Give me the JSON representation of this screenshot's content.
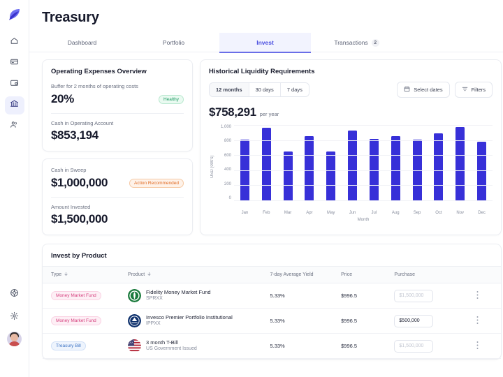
{
  "app": {
    "brand_color": "#4b4fe0",
    "bar_color": "#3730d8",
    "logo_name": "app-logo"
  },
  "sidebar": {
    "items": [
      {
        "icon": "home-icon",
        "label": "Home"
      },
      {
        "icon": "card-icon",
        "label": "Cards"
      },
      {
        "icon": "wallet-icon",
        "label": "Wallet"
      },
      {
        "icon": "bank-icon",
        "label": "Treasury",
        "active": true
      },
      {
        "icon": "users-icon",
        "label": "Team"
      }
    ],
    "bottom": [
      {
        "icon": "help-circle-icon",
        "label": "Help"
      },
      {
        "icon": "gear-icon",
        "label": "Settings"
      }
    ],
    "avatar_name": "user-avatar"
  },
  "header": {
    "title": "Treasury"
  },
  "tabs": [
    {
      "label": "Dashboard",
      "active": false
    },
    {
      "label": "Portfolio",
      "active": false
    },
    {
      "label": "Invest",
      "active": true
    },
    {
      "label": "Transactions",
      "active": false,
      "badge": "2"
    }
  ],
  "operating_expenses": {
    "title": "Operating Expenses Overview",
    "buffer_label": "Buffer for 2 months of operating costs",
    "buffer_value": "20%",
    "buffer_status": "Healthy",
    "cash_label": "Cash in Operating Account",
    "cash_value": "$853,194"
  },
  "sweep": {
    "sweep_label": "Cash in Sweep",
    "sweep_value": "$1,000,000",
    "sweep_status": "Action Recommended",
    "invested_label": "Amount Invested",
    "invested_value": "$1,500,000"
  },
  "liquidity": {
    "title": "Historical Liquidity Requirements",
    "ranges": [
      {
        "label": "12 months",
        "active": true
      },
      {
        "label": "30 days",
        "active": false
      },
      {
        "label": "7 days",
        "active": false
      }
    ],
    "select_dates_label": "Select dates",
    "filters_label": "Filters",
    "headline_amount": "$758,291",
    "headline_period": "per year"
  },
  "chart_data": {
    "type": "bar",
    "title": "Historical Liquidity Requirements",
    "xlabel": "Month",
    "ylabel": "USD (000's)",
    "categories": [
      "Jan",
      "Feb",
      "Mar",
      "Apr",
      "May",
      "Jun",
      "Jul",
      "Aug",
      "Sep",
      "Oct",
      "Nov",
      "Dec"
    ],
    "values": [
      810,
      965,
      645,
      850,
      645,
      930,
      812,
      850,
      810,
      888,
      968,
      775
    ],
    "ylim": [
      0,
      1000
    ],
    "yticks": [
      "0",
      "200",
      "400",
      "600",
      "800",
      "1,000"
    ],
    "grid": true,
    "legend": false,
    "series_color": "#3730d8"
  },
  "invest_table": {
    "title": "Invest by Product",
    "columns": [
      {
        "label": "Type",
        "sortable": true
      },
      {
        "label": "Product",
        "sortable": true
      },
      {
        "label": "7-day Average Yield",
        "sortable": false
      },
      {
        "label": "Price",
        "sortable": false
      },
      {
        "label": "Purchase",
        "sortable": false
      }
    ],
    "rows": [
      {
        "type": "Money Market Fund",
        "type_style": "pink",
        "logo": "fidelity-logo",
        "product": "Fidelity Money Market Fund",
        "ticker": "SPRXX",
        "yield": "5.33%",
        "price": "$996.5",
        "purchase_value": "",
        "purchase_placeholder": "$1,500,000"
      },
      {
        "type": "Money Market Fund",
        "type_style": "pink",
        "logo": "invesco-logo",
        "product": "Invesco Premier Portfolio Institutional",
        "ticker": "IPPXX",
        "yield": "5.33%",
        "price": "$996.5",
        "purchase_value": "$500,000",
        "purchase_placeholder": "$1,500,000"
      },
      {
        "type": "Treasury Bill",
        "type_style": "blue",
        "logo": "us-flag-logo",
        "product": "3 month T-Bill",
        "ticker": "US Government Issued",
        "yield": "5.33%",
        "price": "$996.5",
        "purchase_value": "",
        "purchase_placeholder": "$1,500,000"
      }
    ]
  }
}
